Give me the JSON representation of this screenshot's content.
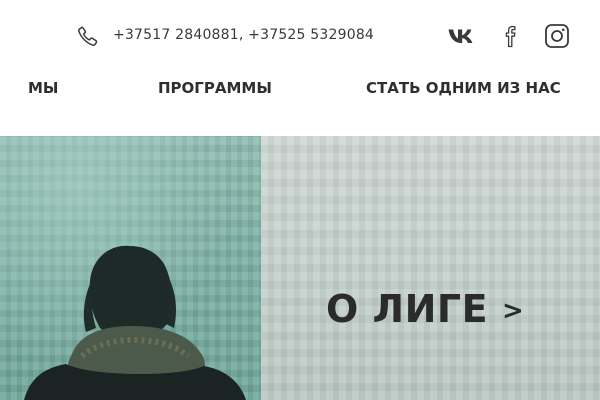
{
  "header": {
    "phone_icon": "phone-icon",
    "phones": "+37517 2840881, +37525 5329084",
    "social": [
      {
        "icon": "vk-icon"
      },
      {
        "icon": "facebook-icon"
      },
      {
        "icon": "instagram-icon"
      }
    ]
  },
  "nav": {
    "items": [
      {
        "label": "МЫ"
      },
      {
        "label": "ПРОГРАММЫ"
      },
      {
        "label": "СТАТЬ ОДНИМ ИЗ НАС"
      }
    ]
  },
  "hero": {
    "cta_label": "О ЛИГЕ",
    "cta_arrow": ">"
  },
  "colors": {
    "text": "#2f2f2f",
    "hero_left": "#7fb2a7",
    "hero_right": "#c4cfcb"
  }
}
